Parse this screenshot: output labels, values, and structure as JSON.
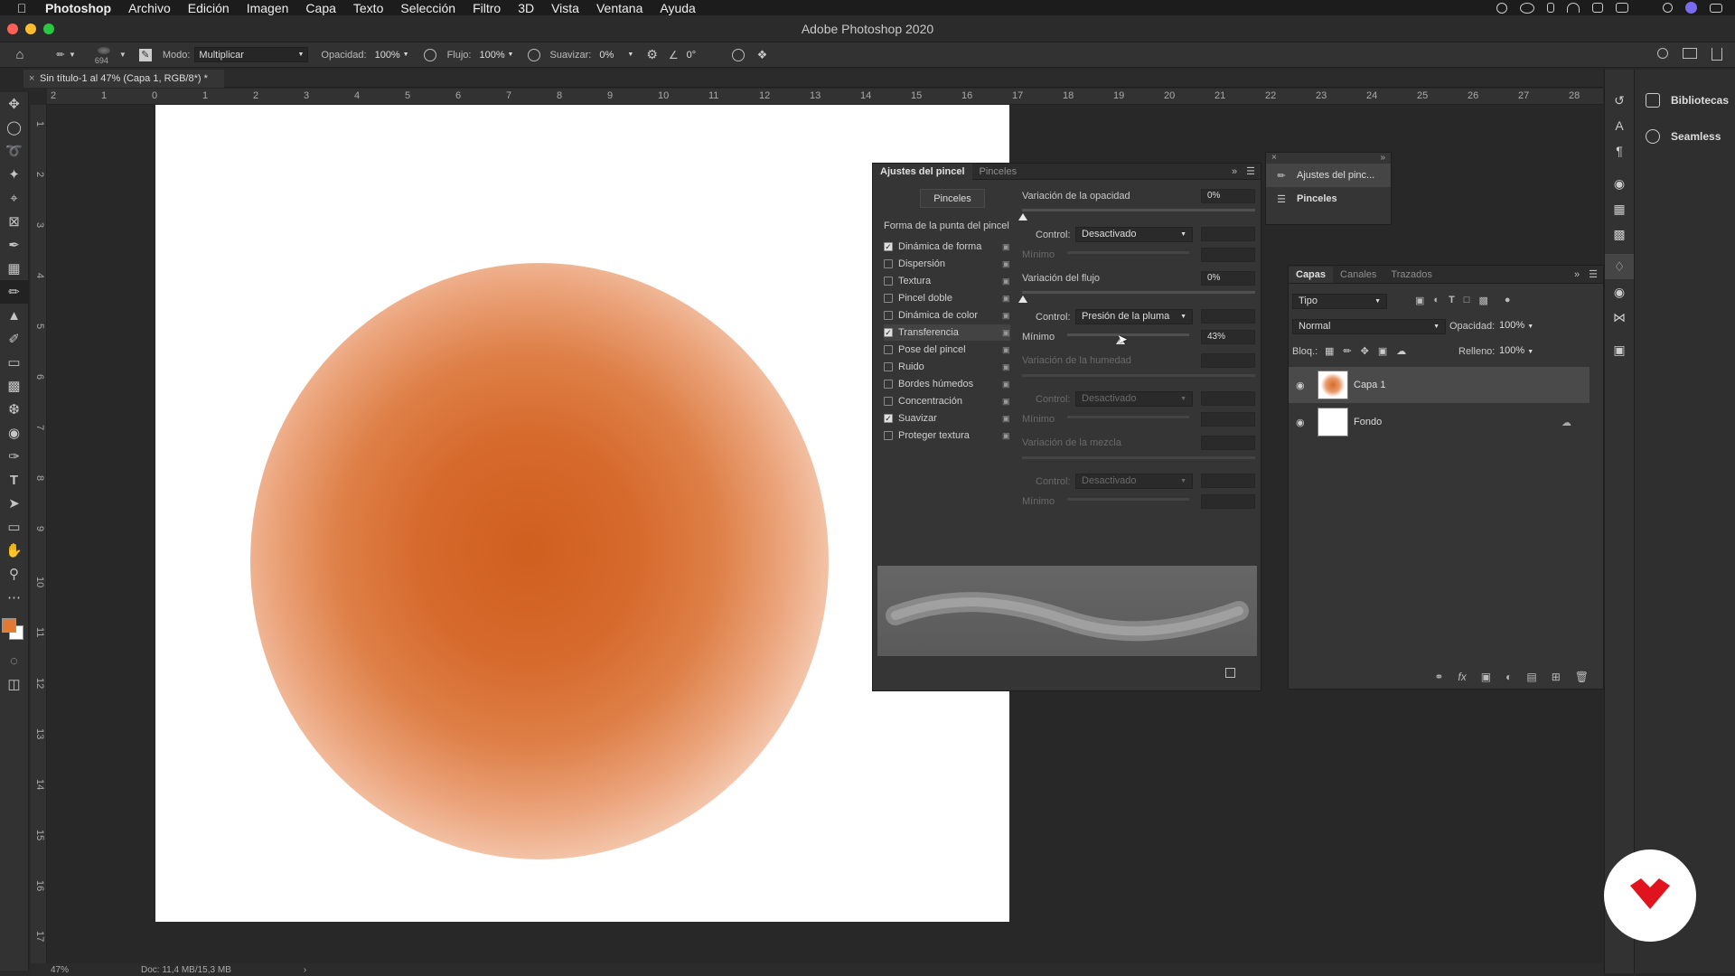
{
  "menubar": {
    "app": "Photoshop",
    "items": [
      "Archivo",
      "Edición",
      "Imagen",
      "Capa",
      "Texto",
      "Selección",
      "Filtro",
      "3D",
      "Vista",
      "Ventana",
      "Ayuda"
    ]
  },
  "titlebar": {
    "title": "Adobe Photoshop 2020"
  },
  "options": {
    "brush_size": "694",
    "modo_label": "Modo:",
    "modo_value": "Multiplicar",
    "opacidad_label": "Opacidad:",
    "opacidad_value": "100%",
    "flujo_label": "Flujo:",
    "flujo_value": "100%",
    "suavizar_label": "Suavizar:",
    "suavizar_value": "0%",
    "angle_value": "0°"
  },
  "document": {
    "tab_title": "Sin título-1 al 47% (Capa 1, RGB/8*) *",
    "zoom": "47%",
    "doc_size": "Doc: 11,4 MB/15,3 MB"
  },
  "rulers": {
    "h_ticks": [
      "2",
      "1",
      "0",
      "1",
      "2",
      "3",
      "4",
      "5",
      "6",
      "7",
      "8",
      "9",
      "10",
      "11",
      "12",
      "13",
      "14",
      "15",
      "16",
      "17",
      "18",
      "19",
      "20",
      "21",
      "22",
      "23",
      "24",
      "25",
      "26",
      "27",
      "28"
    ],
    "v_ticks": [
      "1",
      "2",
      "3",
      "4",
      "5",
      "6",
      "7",
      "8",
      "9",
      "10",
      "11",
      "12",
      "13",
      "14",
      "15",
      "16",
      "17"
    ]
  },
  "brush_panel": {
    "tab_active": "Ajustes del pincel",
    "tab_other": "Pinceles",
    "pinceles_button": "Pinceles",
    "forma_title": "Forma de la punta del pincel",
    "options": [
      {
        "label": "Dinámica de forma",
        "checked": true
      },
      {
        "label": "Dispersión",
        "checked": false
      },
      {
        "label": "Textura",
        "checked": false
      },
      {
        "label": "Pincel doble",
        "checked": false
      },
      {
        "label": "Dinámica de color",
        "checked": false
      },
      {
        "label": "Transferencia",
        "checked": true
      },
      {
        "label": "Pose del pincel",
        "checked": false
      },
      {
        "label": "Ruido",
        "checked": false
      },
      {
        "label": "Bordes húmedos",
        "checked": false
      },
      {
        "label": "Concentración",
        "checked": false
      },
      {
        "label": "Suavizar",
        "checked": true
      },
      {
        "label": "Proteger textura",
        "checked": false
      }
    ],
    "var_opacidad_label": "Variación de la opacidad",
    "var_opacidad_value": "0%",
    "control_label": "Control:",
    "control1_value": "Desactivado",
    "minimo_label": "Mínimo",
    "var_flujo_label": "Variación del flujo",
    "var_flujo_value": "0%",
    "control2_value": "Presión de la pluma",
    "minimo2_value": "43%",
    "var_humedad_label": "Variación de la humedad",
    "control3_value": "Desactivado",
    "var_mezcla_label": "Variación de la mezcla",
    "control4_value": "Desactivado"
  },
  "mini_panel": {
    "item1": "Ajustes del pinc...",
    "item2": "Pinceles"
  },
  "layers_panel": {
    "tabs": [
      "Capas",
      "Canales",
      "Trazados"
    ],
    "filter_value": "Tipo",
    "blend_value": "Normal",
    "opacity_label": "Opacidad:",
    "opacity_value": "100%",
    "lock_label": "Bloq.:",
    "fill_label": "Relleno:",
    "fill_value": "100%",
    "layers": [
      {
        "name": "Capa 1"
      },
      {
        "name": "Fondo"
      }
    ]
  },
  "libraries": {
    "item1": "Bibliotecas",
    "item2": "Seamless"
  },
  "colors": {
    "foreground": "#e07a34",
    "background": "#ffffff",
    "brand_red": "#e0141e"
  }
}
